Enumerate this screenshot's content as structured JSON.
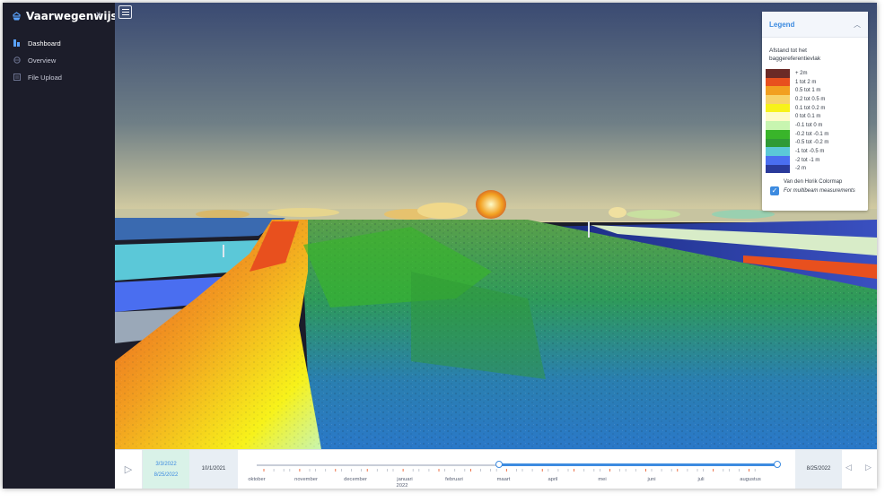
{
  "app": {
    "title": "Vaarwegenwijs"
  },
  "sidebar": {
    "items": [
      {
        "label": "Dashboard",
        "icon": "dashboard-icon",
        "active": true
      },
      {
        "label": "Overview",
        "icon": "globe-icon",
        "active": false
      },
      {
        "label": "File Upload",
        "icon": "file-icon",
        "active": false
      }
    ]
  },
  "legend": {
    "title": "Legend",
    "subtitle": "Afstand tot het baggereferentievlak",
    "entries": [
      {
        "label": "+ 2m",
        "color": "#6b2a26"
      },
      {
        "label": "1 tot 2 m",
        "color": "#e8501e"
      },
      {
        "label": "0.5 tot 1 m",
        "color": "#f2a020"
      },
      {
        "label": "0.2 tot 0.5 m",
        "color": "#f7d36a"
      },
      {
        "label": "0.1 tot 0.2 m",
        "color": "#f7f21a"
      },
      {
        "label": "0 tot 0.1 m",
        "color": "#fdfbc8"
      },
      {
        "label": "-0.1 tot 0 m",
        "color": "#c8f5b0"
      },
      {
        "label": "-0.2 tot -0.1 m",
        "color": "#39b52a"
      },
      {
        "label": "-0.5 tot -0.2 m",
        "color": "#2f9a36"
      },
      {
        "label": "-1 tot -0.5 m",
        "color": "#5bc8d8"
      },
      {
        "label": "-2 tot -1 m",
        "color": "#4a6ef0"
      },
      {
        "label": "-2 m",
        "color": "#2a3a9a"
      }
    ],
    "colormap_label": "Van den Horik Colormap",
    "colormap_checked": true,
    "colormap_note": "For multibeam measurements"
  },
  "timeline": {
    "range_start": "3/3/2022",
    "range_end": "8/25/2022",
    "start_date": "10/1/2021",
    "end_date": "8/25/2022",
    "months": [
      "oktober",
      "november",
      "december",
      "januari",
      "februari",
      "maart",
      "april",
      "mei",
      "juni",
      "juli",
      "augustus"
    ],
    "year": "2022",
    "selection_start_fraction": 0.465,
    "selection_end_fraction": 1.0
  },
  "colors": {
    "accent": "#3d8be0",
    "sidebar_bg": "#1c1d2a",
    "sky_top": "#3a4a72",
    "sky_bottom": "#d9d1a2"
  }
}
